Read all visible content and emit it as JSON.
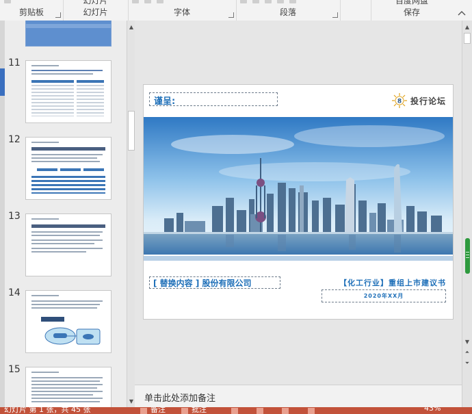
{
  "ribbon": {
    "groups": [
      {
        "id": "clipboard",
        "label": "剪贴板",
        "top": ""
      },
      {
        "id": "slides",
        "label": "幻灯片",
        "top": "幻灯片"
      },
      {
        "id": "font",
        "label": "字体",
        "top": ""
      },
      {
        "id": "paragraph",
        "label": "段落",
        "top": ""
      },
      {
        "id": "drawing",
        "label": "",
        "top": ""
      },
      {
        "id": "save",
        "label": "保存",
        "top": "百度网盘"
      }
    ]
  },
  "thumbnails": [
    {
      "number": "11"
    },
    {
      "number": "12"
    },
    {
      "number": "13"
    },
    {
      "number": "14"
    },
    {
      "number": "15"
    }
  ],
  "slide": {
    "to_label": "谨呈:",
    "logo_text": "投行论坛",
    "logo_number": "8",
    "company": "[ 替换内容 ] 股份有限公司",
    "proposal": "【化工行业】重组上市建议书",
    "date": "2020年XX月",
    "accent_color": "#1e6fb8"
  },
  "notes": {
    "placeholder": "单击此处添加备注"
  },
  "status": {
    "slide_info": "幻灯片 第 1 张，共 45 张",
    "notes_btn": "备注",
    "comments_btn": "批注",
    "zoom": "43%"
  }
}
